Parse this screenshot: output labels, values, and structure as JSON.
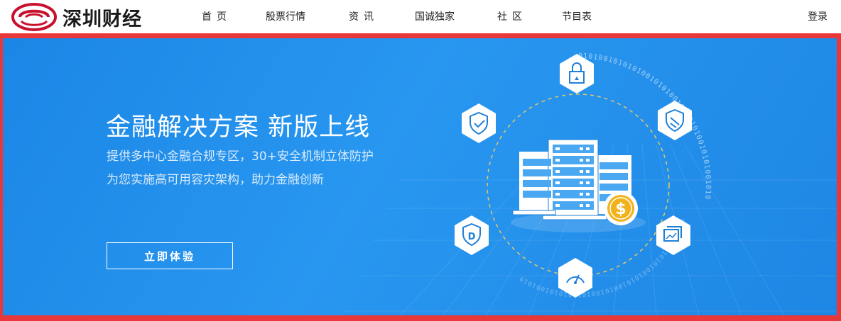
{
  "header": {
    "logo_text": "深圳财经",
    "nav": [
      {
        "label": "首页"
      },
      {
        "label": "股票行情"
      },
      {
        "label": "资讯"
      },
      {
        "label": "国诚独家"
      },
      {
        "label": "社区"
      },
      {
        "label": "节目表"
      }
    ],
    "login_label": "登录"
  },
  "banner": {
    "title": "金融解决方案 新版上线",
    "subtitle_lines": [
      "提供多中心金融合规专区，30+安全机制立体防护",
      "为您实施高可用容灾架构，助力金融创新"
    ],
    "cta_label": "立即体验",
    "orbit_digits": "0101001010101001010100101001010010101001010",
    "icons": [
      "lock-icon",
      "shield-icon",
      "shield-check-icon",
      "d-badge-icon",
      "gauge-icon",
      "chart-window-icon",
      "dollar-coin-icon",
      "server-rack-icon"
    ]
  },
  "colors": {
    "brand_red": "#c8102e",
    "banner_blue": "#1f8ae8",
    "frame_red": "#e8383a",
    "coin_gold": "#f2b21b"
  }
}
